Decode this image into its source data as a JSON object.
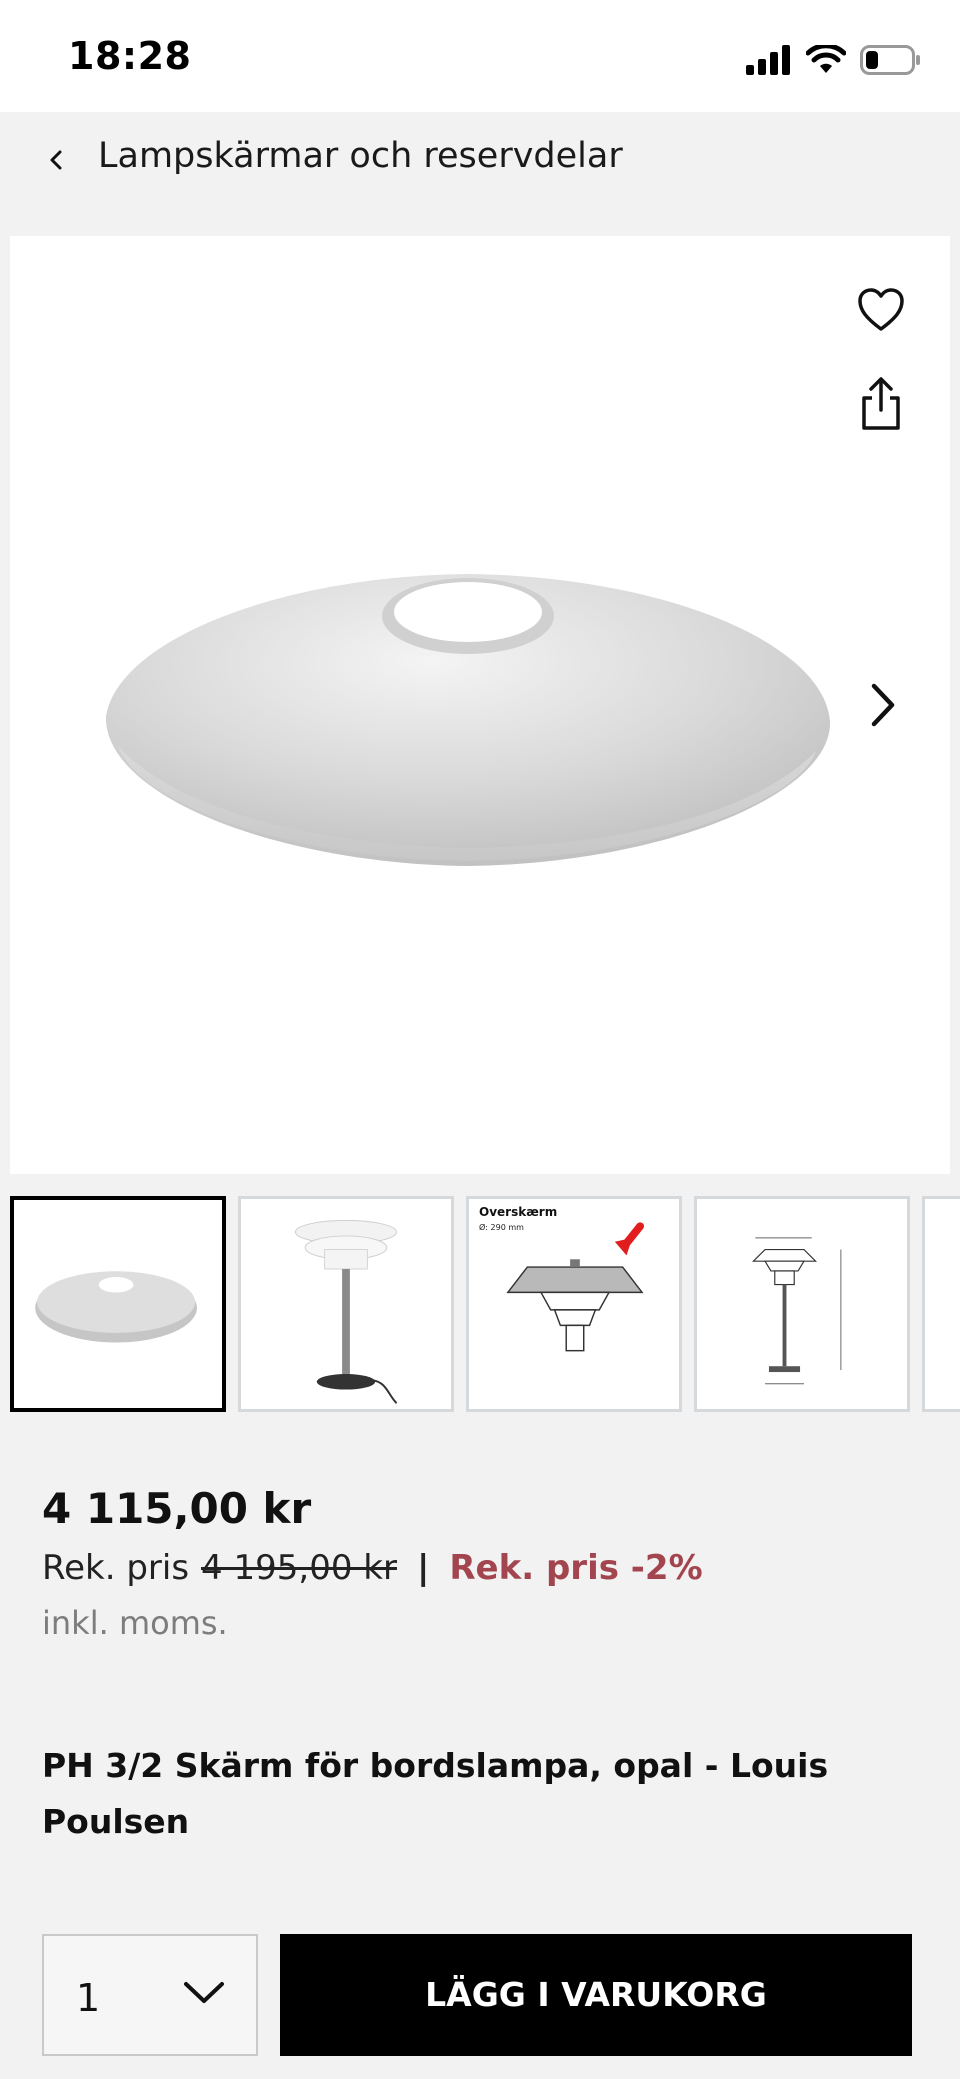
{
  "status_bar": {
    "time": "18:28"
  },
  "header": {
    "back_label": "Lampskärmar och reservdelar"
  },
  "gallery": {
    "thumbnails": [
      {
        "label": "",
        "sublabel": ""
      },
      {
        "label": "",
        "sublabel": ""
      },
      {
        "label": "Overskærm",
        "sublabel": "Ø: 290 mm"
      },
      {
        "label": "",
        "sublabel": ""
      },
      {
        "label": "",
        "sublabel": ""
      }
    ]
  },
  "product": {
    "price": "4 115,00 kr",
    "rek_label": "Rek. pris",
    "rek_old_price": "4 195,00 kr",
    "separator": "|",
    "rek_discount": "Rek. pris -2%",
    "vat_note": "inkl. moms.",
    "title": "PH 3/2 Skärm för bordslampa, opal - Louis Poulsen"
  },
  "purchase": {
    "quantity": "1",
    "add_to_cart_label": "LÄGG I VARUKORG"
  },
  "colors": {
    "discount": "#a3454e",
    "button": "#000000",
    "background": "#f2f2f2"
  }
}
